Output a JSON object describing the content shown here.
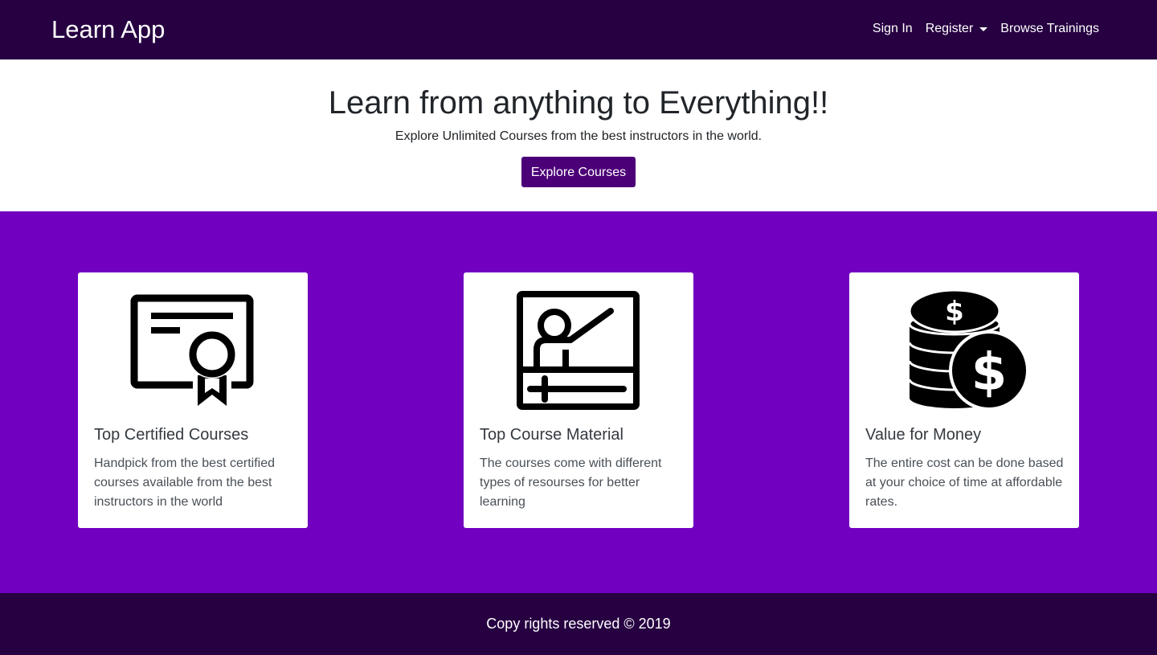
{
  "navbar": {
    "brand": "Learn App",
    "links": [
      {
        "label": "Sign In"
      },
      {
        "label": "Register",
        "dropdown": true
      },
      {
        "label": "Browse Trainings"
      }
    ]
  },
  "hero": {
    "title": "Learn from anything to Everything!!",
    "subtitle": "Explore Unlimited Courses from the best instructors in the world.",
    "button_label": "Explore Courses"
  },
  "features": [
    {
      "icon": "certificate-icon",
      "title": "Top Certified Courses",
      "text": "Handpick from the best certified courses available from the best instructors in the world"
    },
    {
      "icon": "presentation-icon",
      "title": "Top Course Material",
      "text": "The courses come with different types of resourses for better learning"
    },
    {
      "icon": "coins-dollar-icon",
      "title": "Value for Money",
      "text": "The entire cost can be done based at your choice of time at affordable rates."
    }
  ],
  "footer": {
    "text": "Copy rights reserved © 2019"
  },
  "colors": {
    "navbar_bg": "#260041",
    "features_bg": "#7100c1",
    "button_bg": "#4c0078"
  }
}
